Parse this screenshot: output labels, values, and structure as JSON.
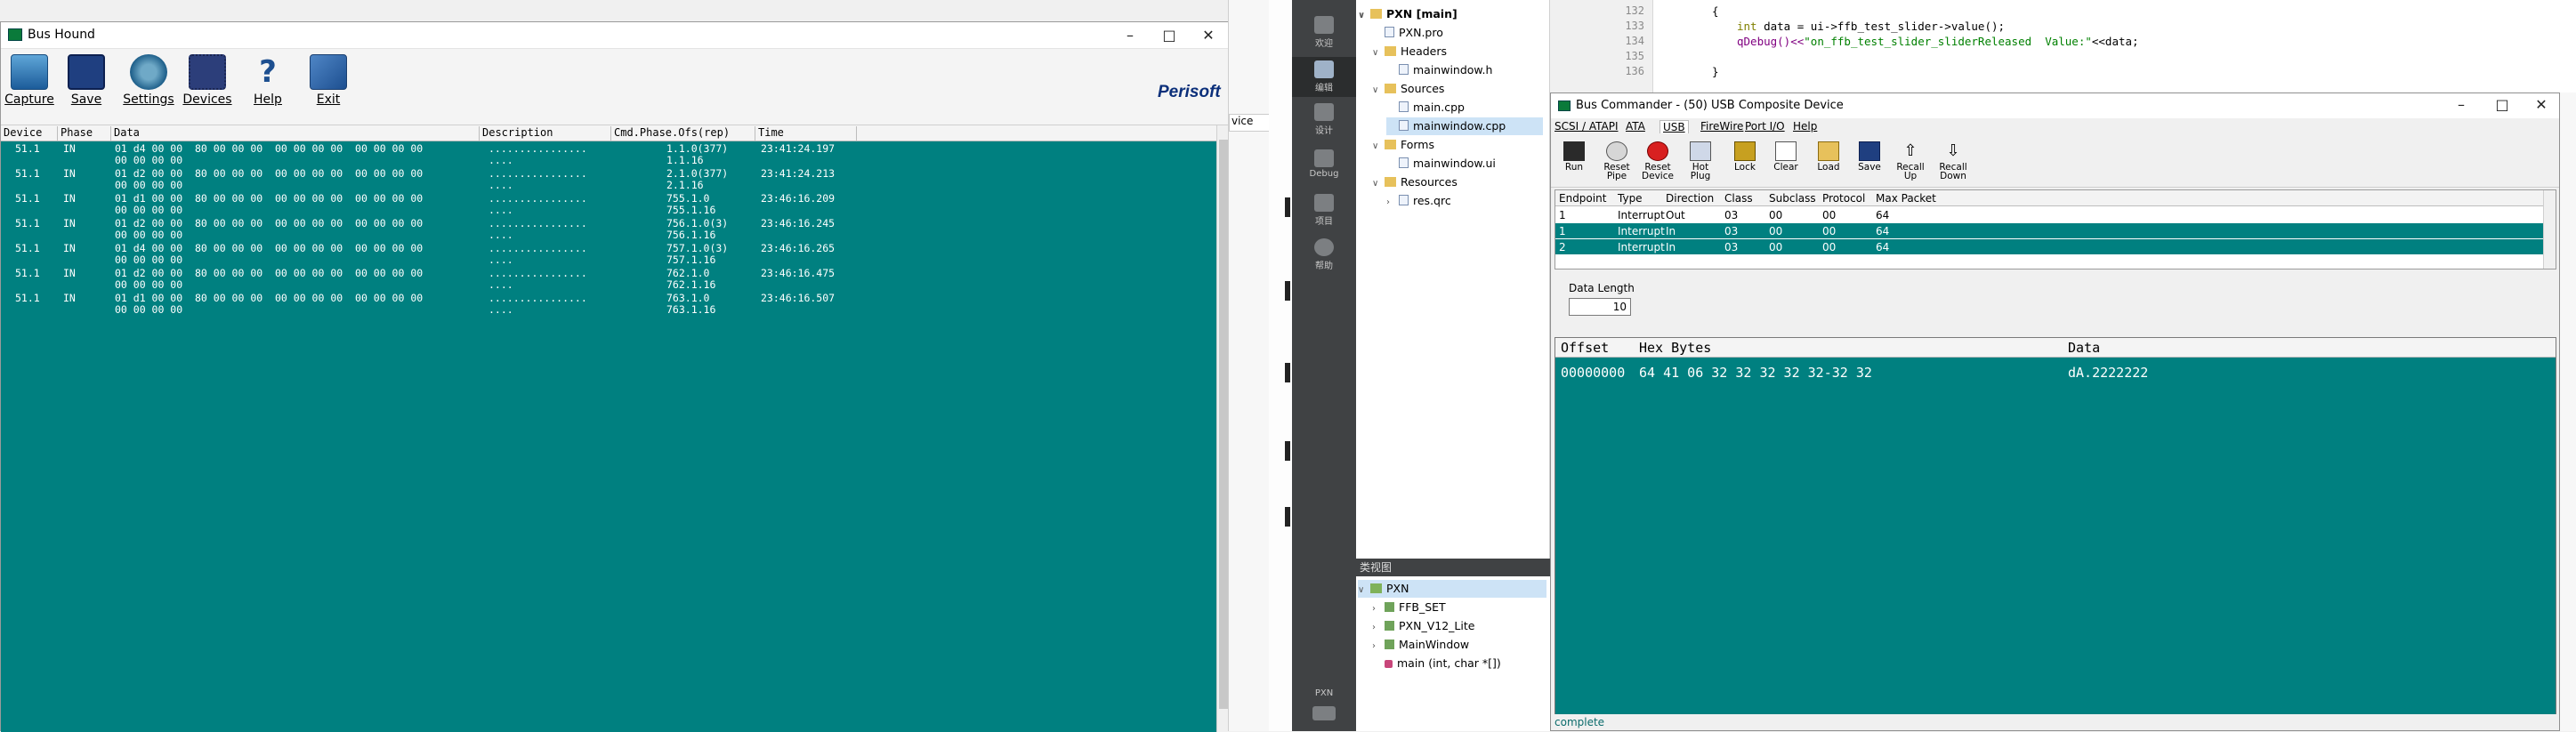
{
  "bus_hound": {
    "title": "Bus Hound",
    "toolbar": [
      "Capture",
      "Save",
      "Settings",
      "Devices",
      "Help",
      "Exit"
    ],
    "logo": "Perisoft",
    "columns": [
      "Device",
      "Phase",
      "Data",
      "Description",
      "Cmd.Phase.Ofs(rep)",
      "Time"
    ],
    "rows": [
      {
        "device": "51.1",
        "phase": "IN",
        "data1": "01 d4 00 00  80 00 00 00  00 00 00 00  00 00 00 00",
        "data2": "00 00 00 00",
        "desc1": "................",
        "desc2": "....",
        "cmd1": "1.1.0(377)",
        "cmd2": "1.1.16",
        "time": "23:41:24.197"
      },
      {
        "device": "51.1",
        "phase": "IN",
        "data1": "01 d2 00 00  80 00 00 00  00 00 00 00  00 00 00 00",
        "data2": "00 00 00 00",
        "desc1": "................",
        "desc2": "....",
        "cmd1": "2.1.0(377)",
        "cmd2": "2.1.16",
        "time": "23:41:24.213"
      },
      {
        "device": "51.1",
        "phase": "IN",
        "data1": "01 d1 00 00  80 00 00 00  00 00 00 00  00 00 00 00",
        "data2": "00 00 00 00",
        "desc1": "................",
        "desc2": "....",
        "cmd1": "755.1.0",
        "cmd2": "755.1.16",
        "time": "23:46:16.209"
      },
      {
        "device": "51.1",
        "phase": "IN",
        "data1": "01 d2 00 00  80 00 00 00  00 00 00 00  00 00 00 00",
        "data2": "00 00 00 00",
        "desc1": "................",
        "desc2": "....",
        "cmd1": "756.1.0(3)",
        "cmd2": "756.1.16",
        "time": "23:46:16.245"
      },
      {
        "device": "51.1",
        "phase": "IN",
        "data1": "01 d4 00 00  80 00 00 00  00 00 00 00  00 00 00 00",
        "data2": "00 00 00 00",
        "desc1": "................",
        "desc2": "....",
        "cmd1": "757.1.0(3)",
        "cmd2": "757.1.16",
        "time": "23:46:16.265"
      },
      {
        "device": "51.1",
        "phase": "IN",
        "data1": "01 d2 00 00  80 00 00 00  00 00 00 00  00 00 00 00",
        "data2": "00 00 00 00",
        "desc1": "................",
        "desc2": "....",
        "cmd1": "762.1.0",
        "cmd2": "762.1.16",
        "time": "23:46:16.475"
      },
      {
        "device": "51.1",
        "phase": "IN",
        "data1": "01 d1 00 00  80 00 00 00  00 00 00 00  00 00 00 00",
        "data2": "00 00 00 00",
        "desc1": "................",
        "desc2": "....",
        "cmd1": "763.1.0",
        "cmd2": "763.1.16",
        "time": "23:46:16.507"
      }
    ]
  },
  "middle": {
    "tab_fragment": "vice"
  },
  "qt_sidebar": [
    {
      "label": "欢迎"
    },
    {
      "label": "编辑"
    },
    {
      "label": "设计"
    },
    {
      "label": "Debug"
    },
    {
      "label": "项目"
    },
    {
      "label": "帮助"
    }
  ],
  "qt_bottom": {
    "kit": "PXN"
  },
  "project_tree": {
    "root": "PXN [main]",
    "pro_file": "PXN.pro",
    "headers_label": "Headers",
    "header_file": "mainwindow.h",
    "sources_label": "Sources",
    "source_files": [
      "main.cpp",
      "mainwindow.cpp"
    ],
    "forms_label": "Forms",
    "form_file": "mainwindow.ui",
    "resources_label": "Resources",
    "resource_file": "res.qrc"
  },
  "class_view": {
    "header": "类视图",
    "root": "PXN",
    "items": [
      "FFB_SET",
      "PXN_V12_Lite",
      "MainWindow",
      "main (int, char *[])"
    ]
  },
  "editor": {
    "line_numbers": [
      "132",
      "133",
      "134",
      "135",
      "136"
    ],
    "line132": "{",
    "line133_type": "int",
    "line133_rest": " data = ui->ffb_test_slider->value();",
    "line134_call": "qDebug()<<",
    "line134_str": "\"on_ffb_test_slider_sliderReleased  Value:\"",
    "line134_end": "<<data;",
    "line136": "}"
  },
  "bus_commander": {
    "title": "Bus Commander - (50) USB Composite Device",
    "menu": [
      "SCSI / ATAPI",
      "ATA",
      "USB",
      "FireWire",
      "Port I/O",
      "Help"
    ],
    "toolbar": [
      {
        "l1": "Run",
        "l2": ""
      },
      {
        "l1": "Reset",
        "l2": "Pipe"
      },
      {
        "l1": "Reset",
        "l2": "Device"
      },
      {
        "l1": "Hot Plug",
        "l2": ""
      },
      {
        "l1": "Lock",
        "l2": ""
      },
      {
        "l1": "Clear",
        "l2": ""
      },
      {
        "l1": "Load",
        "l2": ""
      },
      {
        "l1": "Save",
        "l2": ""
      },
      {
        "l1": "Recall",
        "l2": "Up"
      },
      {
        "l1": "Recall",
        "l2": "Down"
      }
    ],
    "endpoint_columns": [
      "Endpoint",
      "Type",
      "Direction",
      "Class",
      "Subclass",
      "Protocol",
      "Max Packet"
    ],
    "endpoints": [
      [
        "1",
        "Interrupt",
        "Out",
        "03",
        "00",
        "00",
        "64"
      ],
      [
        "1",
        "Interrupt",
        "In",
        "03",
        "00",
        "00",
        "64"
      ],
      [
        "2",
        "Interrupt",
        "In",
        "03",
        "00",
        "00",
        "64"
      ]
    ],
    "data_length_label": "Data Length",
    "data_length_value": "10",
    "hex_columns": [
      "Offset",
      "Hex Bytes",
      "Data"
    ],
    "hex_row": {
      "offset": "00000000",
      "bytes": "64 41 06 32 32 32 32 32-32 32",
      "data": "dA.2222222"
    },
    "status": "complete"
  }
}
